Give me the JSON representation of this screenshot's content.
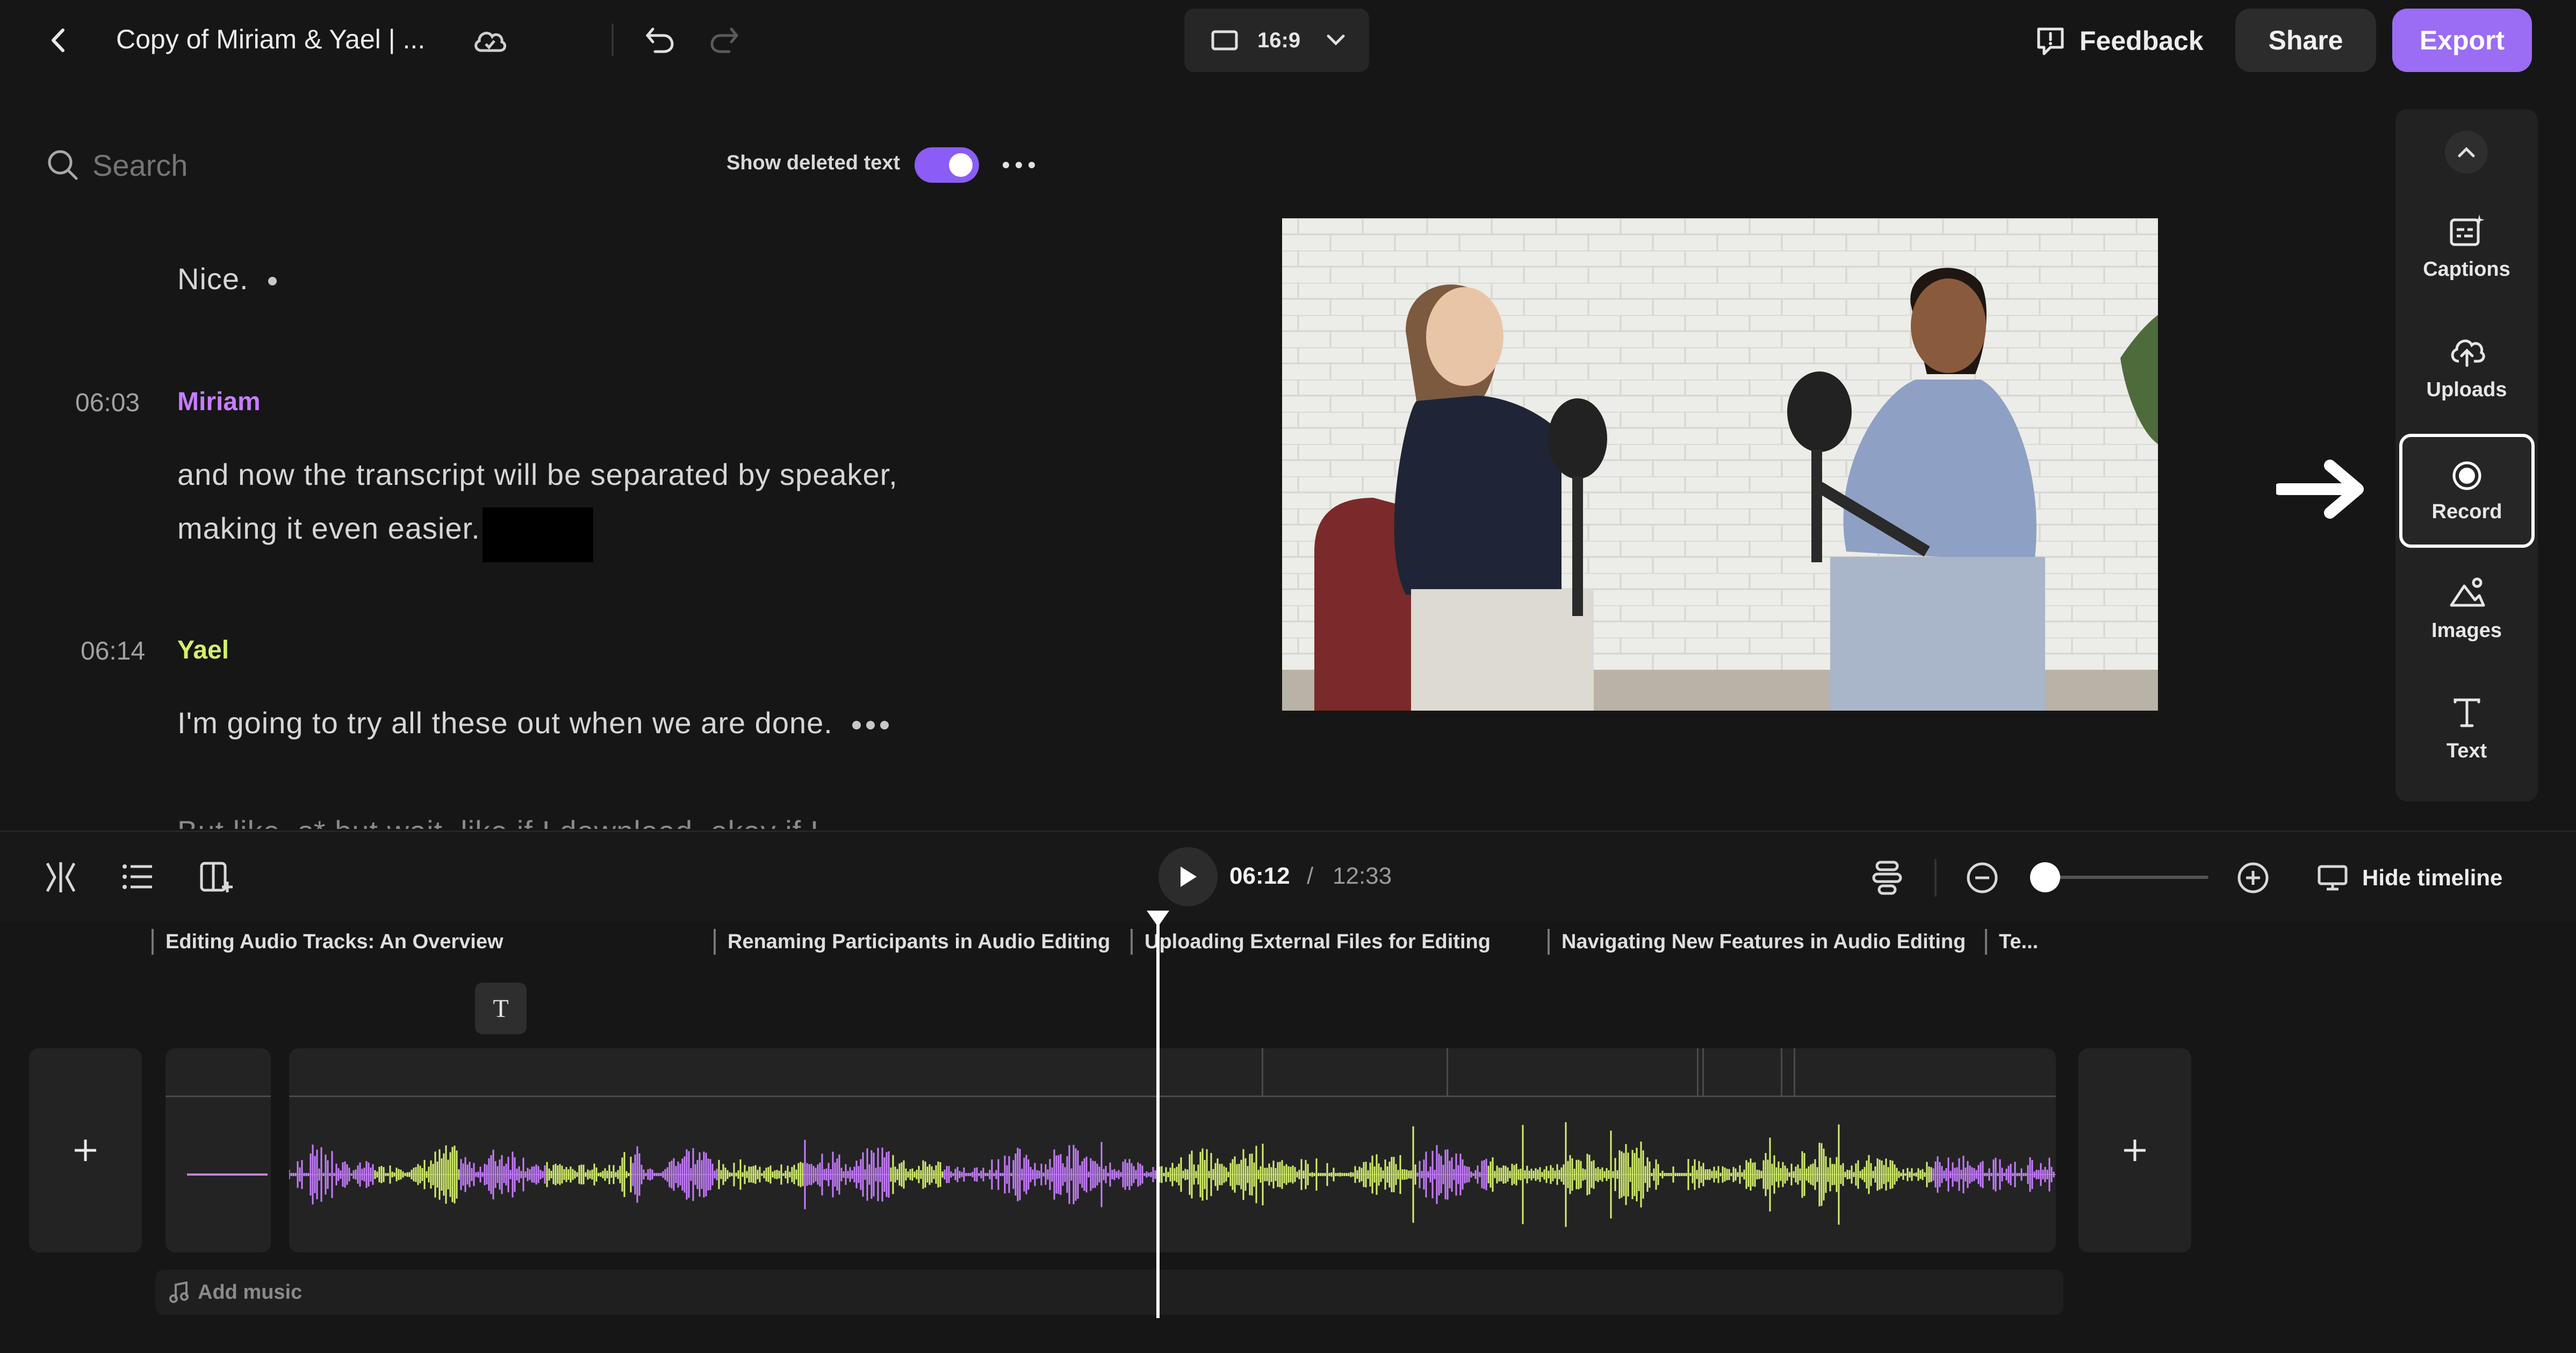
{
  "header": {
    "project_title": "Copy of Miriam & Yael | ...",
    "aspect_ratio": "16:9",
    "feedback_label": "Feedback",
    "share_label": "Share",
    "export_label": "Export"
  },
  "search": {
    "placeholder": "Search"
  },
  "toggle": {
    "label": "Show deleted text",
    "on": true
  },
  "transcript": {
    "line0": "Nice.",
    "blocks": [
      {
        "time": "06:03",
        "speaker": "Miriam",
        "line1": "and now the transcript will be separated by speaker,",
        "line2": "making it even easier."
      },
      {
        "time": "06:14",
        "speaker": "Yael",
        "line1": "I'm going to try all these out when we are done."
      }
    ],
    "cutoff_line": "But like, s* but wait, like if I download, okay if I"
  },
  "sidebar": {
    "items": [
      {
        "label": "Captions",
        "icon": "captions-icon"
      },
      {
        "label": "Uploads",
        "icon": "upload-cloud-icon"
      },
      {
        "label": "Record",
        "icon": "record-icon"
      },
      {
        "label": "Images",
        "icon": "images-icon"
      },
      {
        "label": "Text",
        "icon": "text-icon"
      }
    ]
  },
  "playback": {
    "current": "06:12",
    "separator": "/",
    "total": "12:33",
    "hide_timeline_label": "Hide timeline"
  },
  "timeline": {
    "chapters": [
      "Editing Audio Tracks: An Overview",
      "Renaming Participants in Audio Editing",
      "Uploading External Files for Editing",
      "Navigating New Features in Audio Editing",
      "Te..."
    ],
    "add_music_label": "Add music",
    "text_track_glyph": "T"
  },
  "colors": {
    "miriam": "#c77dff",
    "yael": "#d4f06c",
    "accent": "#8b5cf6",
    "background": "#161616"
  }
}
